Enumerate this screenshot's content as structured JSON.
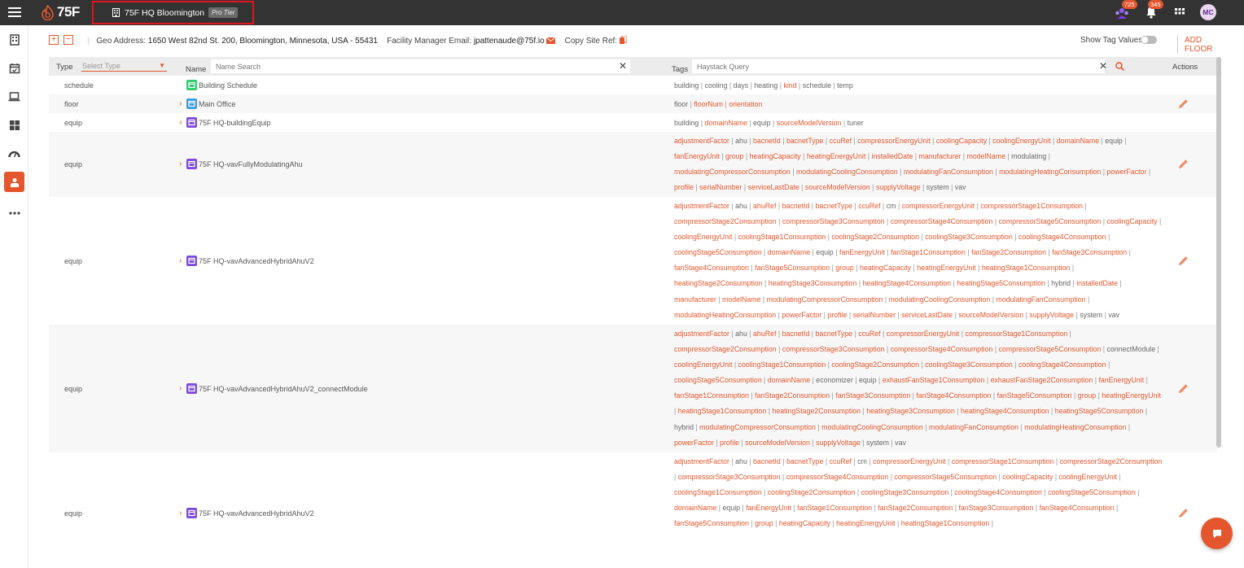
{
  "topbar": {
    "logo_text": "75F",
    "site_name": "75F HQ Bloomington",
    "tier_badge": "Pro Tier",
    "notif_count_1": "725",
    "notif_count_2": "345",
    "avatar": "MC",
    "accent": "#e4572e"
  },
  "info": {
    "geo_label": "Geo Address:",
    "geo_value": "1650 West 82nd St. 200, Bloomington, Minnesota, USA - 55431",
    "fm_label": "Facility Manager Email:",
    "fm_value": "jpattenaude@75f.io",
    "copy_ref": "Copy Site Ref:",
    "show_tags": "Show Tag Values",
    "add_floor": "ADD FLOOR"
  },
  "table": {
    "type_header": "Type",
    "type_placeholder": "Select Type",
    "name_header": "Name",
    "name_placeholder": "Name Search",
    "tags_header": "Tags",
    "tags_placeholder": "Haystack Query",
    "actions_header": "Actions"
  },
  "rows": [
    {
      "type": "schedule",
      "name": "Building Schedule",
      "icon": "calendar-icon",
      "expand": false,
      "edit": false,
      "tags": [
        "building",
        "cooling",
        "days",
        "heating",
        "*kind",
        "schedule",
        "temp"
      ]
    },
    {
      "type": "floor",
      "name": "Main Office",
      "icon": "layers-icon",
      "expand": true,
      "edit": true,
      "tags": [
        "floor",
        "*floorNum",
        "*orientation"
      ]
    },
    {
      "type": "equip",
      "name": "75F HQ-buildingEquip",
      "icon": "equip-icon",
      "expand": true,
      "edit": false,
      "tags": [
        "building",
        "*domainName",
        "equip",
        "*sourceModelVersion",
        "tuner"
      ]
    },
    {
      "type": "equip",
      "name": "75F HQ-vavFullyModulatingAhu",
      "icon": "equip-icon",
      "expand": true,
      "edit": true,
      "tags": [
        "*adjustmentFactor",
        "ahu",
        "*bacnetId",
        "*bacnetType",
        "*ccuRef",
        "*compressorEnergyUnit",
        "*coolingCapacity",
        "*coolingEnergyUnit",
        "*domainName",
        "equip",
        "*fanEnergyUnit",
        "*group",
        "*heatingCapacity",
        "*heatingEnergyUnit",
        "*installedDate",
        "*manufacturer",
        "*modelName",
        "modulating",
        "*modulatingCompressorConsumption",
        "*modulatingCoolingConsumption",
        "*modulatingFanConsumption",
        "*modulatingHeatingConsumption",
        "*powerFactor",
        "*profile",
        "*serialNumber",
        "*serviceLastDate",
        "*sourceModelVersion",
        "*supplyVoltage",
        "system",
        "vav"
      ]
    },
    {
      "type": "equip",
      "name": "75F HQ-vavAdvancedHybridAhuV2",
      "icon": "equip-icon",
      "expand": true,
      "edit": true,
      "tags": [
        "*adjustmentFactor",
        "ahu",
        "*ahuRef",
        "*bacnetId",
        "*bacnetType",
        "*ccuRef",
        "cm",
        "*compressorEnergyUnit",
        "*compressorStage1Consumption",
        "*compressorStage2Consumption",
        "*compressorStage3Consumption",
        "*compressorStage4Consumption",
        "*compressorStage5Consumption",
        "*coolingCapacity",
        "*coolingEnergyUnit",
        "*coolingStage1Consumption",
        "*coolingStage2Consumption",
        "*coolingStage3Consumption",
        "*coolingStage4Consumption",
        "*coolingStage5Consumption",
        "*domainName",
        "equip",
        "*fanEnergyUnit",
        "*fanStage1Consumption",
        "*fanStage2Consumption",
        "*fanStage3Consumption",
        "*fanStage4Consumption",
        "*fanStage5Consumption",
        "*group",
        "*heatingCapacity",
        "*heatingEnergyUnit",
        "*heatingStage1Consumption",
        "*heatingStage2Consumption",
        "*heatingStage3Consumption",
        "*heatingStage4Consumption",
        "*heatingStage5Consumption",
        "hybrid",
        "*installedDate",
        "*manufacturer",
        "*modelName",
        "*modulatingCompressorConsumption",
        "*modulatingCoolingConsumption",
        "*modulatingFanConsumption",
        "*modulatingHeatingConsumption",
        "*powerFactor",
        "*profile",
        "*serialNumber",
        "*serviceLastDate",
        "*sourceModelVersion",
        "*supplyVoltage",
        "system",
        "vav"
      ]
    },
    {
      "type": "equip",
      "name": "75F HQ-vavAdvancedHybridAhuV2_connectModule",
      "icon": "equip-icon",
      "expand": true,
      "edit": true,
      "tags": [
        "*adjustmentFactor",
        "ahu",
        "*ahuRef",
        "*bacnetId",
        "*bacnetType",
        "*ccuRef",
        "*compressorEnergyUnit",
        "*compressorStage1Consumption",
        "*compressorStage2Consumption",
        "*compressorStage3Consumption",
        "*compressorStage4Consumption",
        "*compressorStage5Consumption",
        "connectModule",
        "*coolingEnergyUnit",
        "*coolingStage1Consumption",
        "*coolingStage2Consumption",
        "*coolingStage3Consumption",
        "*coolingStage4Consumption",
        "*coolingStage5Consumption",
        "*domainName",
        "economizer",
        "equip",
        "*exhaustFanStage1Consumption",
        "*exhaustFanStage2Consumption",
        "*fanEnergyUnit",
        "*fanStage1Consumption",
        "*fanStage2Consumption",
        "*fanStage3Consumption",
        "*fanStage4Consumption",
        "*fanStage5Consumption",
        "*group",
        "*heatingEnergyUnit",
        "*heatingStage1Consumption",
        "*heatingStage2Consumption",
        "*heatingStage3Consumption",
        "*heatingStage4Consumption",
        "*heatingStage5Consumption",
        "hybrid",
        "*modulatingCompressorConsumption",
        "*modulatingCoolingConsumption",
        "*modulatingFanConsumption",
        "*modulatingHeatingConsumption",
        "*powerFactor",
        "*profile",
        "*sourceModelVersion",
        "*supplyVoltage",
        "system",
        "vav"
      ]
    },
    {
      "type": "equip",
      "name": "75F HQ-vavAdvancedHybridAhuV2",
      "icon": "equip-icon",
      "expand": true,
      "edit": true,
      "tags": [
        "*adjustmentFactor",
        "ahu",
        "*bacnetId",
        "*bacnetType",
        "*ccuRef",
        "cm",
        "*compressorEnergyUnit",
        "*compressorStage1Consumption",
        "*compressorStage2Consumption",
        "*compressorStage3Consumption",
        "*compressorStage4Consumption",
        "*compressorStage5Consumption",
        "*coolingCapacity",
        "*coolingEnergyUnit",
        "*coolingStage1Consumption",
        "*coolingStage2Consumption",
        "*coolingStage3Consumption",
        "*coolingStage4Consumption",
        "*coolingStage5Consumption",
        "*domainName",
        "equip",
        "*fanEnergyUnit",
        "*fanStage1Consumption",
        "*fanStage2Consumption",
        "*fanStage3Consumption",
        "*fanStage4Consumption",
        "*fanStage5Consumption",
        "*group",
        "*heatingCapacity",
        "*heatingEnergyUnit",
        "*heatingStage1Consumption",
        ""
      ]
    }
  ]
}
